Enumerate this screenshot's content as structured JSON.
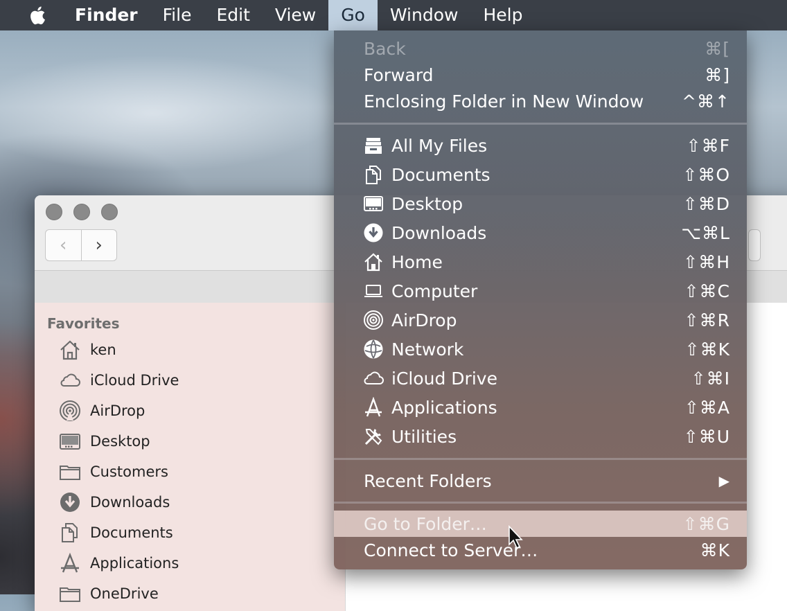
{
  "menubar": {
    "apple_icon": "apple-logo-icon",
    "items": [
      {
        "label": "Finder",
        "bold": true
      },
      {
        "label": "File"
      },
      {
        "label": "Edit"
      },
      {
        "label": "View"
      },
      {
        "label": "Go",
        "active": true
      },
      {
        "label": "Window"
      },
      {
        "label": "Help"
      }
    ]
  },
  "go_menu": {
    "navigation": [
      {
        "label": "Back",
        "shortcut": "⌘[",
        "disabled": true
      },
      {
        "label": "Forward",
        "shortcut": "⌘]"
      },
      {
        "label": "Enclosing Folder in New Window",
        "shortcut": "^⌘↑"
      }
    ],
    "locations": [
      {
        "label": "All My Files",
        "shortcut": "⇧⌘F",
        "icon": "all-my-files-icon"
      },
      {
        "label": "Documents",
        "shortcut": "⇧⌘O",
        "icon": "documents-icon"
      },
      {
        "label": "Desktop",
        "shortcut": "⇧⌘D",
        "icon": "desktop-icon"
      },
      {
        "label": "Downloads",
        "shortcut": "⌥⌘L",
        "icon": "downloads-icon"
      },
      {
        "label": "Home",
        "shortcut": "⇧⌘H",
        "icon": "home-icon"
      },
      {
        "label": "Computer",
        "shortcut": "⇧⌘C",
        "icon": "computer-icon"
      },
      {
        "label": "AirDrop",
        "shortcut": "⇧⌘R",
        "icon": "airdrop-icon"
      },
      {
        "label": "Network",
        "shortcut": "⇧⌘K",
        "icon": "network-icon"
      },
      {
        "label": "iCloud Drive",
        "shortcut": "⇧⌘I",
        "icon": "icloud-icon"
      },
      {
        "label": "Applications",
        "shortcut": "⇧⌘A",
        "icon": "applications-icon"
      },
      {
        "label": "Utilities",
        "shortcut": "⇧⌘U",
        "icon": "utilities-icon"
      }
    ],
    "recent_folders": {
      "label": "Recent Folders",
      "submenu_indicator": "▶"
    },
    "go_to_folder": {
      "label": "Go to Folder…",
      "shortcut": "⇧⌘G",
      "highlighted": true
    },
    "connect_to_server": {
      "label": "Connect to Server…",
      "shortcut": "⌘K"
    }
  },
  "finder_window": {
    "back_glyph": "‹",
    "forward_glyph": "›",
    "sidebar": {
      "section_title": "Favorites",
      "items": [
        {
          "label": "ken",
          "icon": "home-icon"
        },
        {
          "label": "iCloud Drive",
          "icon": "icloud-icon"
        },
        {
          "label": "AirDrop",
          "icon": "airdrop-icon"
        },
        {
          "label": "Desktop",
          "icon": "desktop-icon"
        },
        {
          "label": "Customers",
          "icon": "folder-icon"
        },
        {
          "label": "Downloads",
          "icon": "downloads-icon"
        },
        {
          "label": "Documents",
          "icon": "documents-icon"
        },
        {
          "label": "Applications",
          "icon": "applications-icon"
        },
        {
          "label": "OneDrive",
          "icon": "folder-icon"
        }
      ]
    }
  },
  "colors": {
    "menubar_bg": "#3a3f47",
    "active_menu_bg": "#bfd0e0",
    "highlight_row": "#e1cdc8",
    "sidebar_bg": "#f3e3e1"
  }
}
